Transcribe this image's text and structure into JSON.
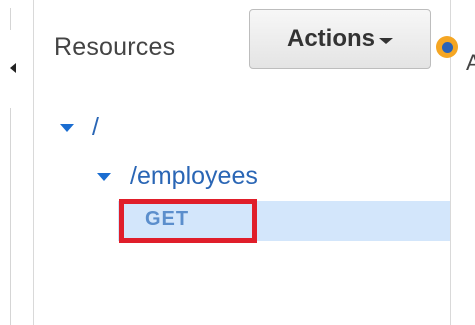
{
  "panel": {
    "title": "Resources",
    "actions_label": "Actions",
    "cut_off_text": "A"
  },
  "tree": {
    "root": {
      "path": "/"
    },
    "employees": {
      "path": "/employees"
    },
    "method": {
      "label": "GET",
      "selected": true
    }
  },
  "colors": {
    "link": "#2a66b5",
    "selection": "#d3e6fb",
    "highlight_box": "#e01e2a",
    "status_dot_outer": "#f5a623",
    "status_dot_inner": "#2a63b8"
  },
  "icons": [
    "collapse-arrow-icon",
    "caret-down-icon",
    "status-dot-icon",
    "expand-triangle-icon"
  ]
}
